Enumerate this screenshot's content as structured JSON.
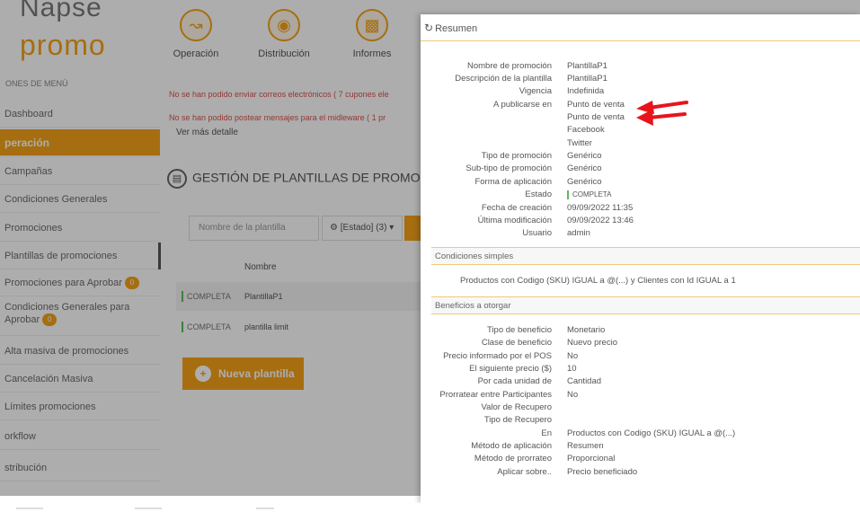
{
  "app": {
    "logo_top": "Napse",
    "logo_bottom": "promo",
    "menu_header": "ONES DE MENÚ",
    "menu": [
      {
        "label": "Dashboard"
      },
      {
        "label": "peración"
      },
      {
        "label": "Campañas"
      },
      {
        "label": "Condiciones Generales"
      },
      {
        "label": "Promociones"
      },
      {
        "label": "Plantillas de promociones"
      },
      {
        "label": "Promociones para Aprobar",
        "badge": "0"
      },
      {
        "label": "Condiciones Generales para",
        "label2": "Aprobar",
        "badge": "0"
      },
      {
        "label": "Alta masiva de promociones"
      },
      {
        "label": "Cancelación Masiva"
      },
      {
        "label": "Límites promociones"
      },
      {
        "label": "orkflow"
      },
      {
        "label": "stribución"
      }
    ],
    "topnav": [
      {
        "label": "Operación",
        "icon": "chart-line-icon"
      },
      {
        "label": "Distribución",
        "icon": "location-pin-icon"
      },
      {
        "label": "Informes",
        "icon": "bar-chart-icon"
      }
    ],
    "errors": [
      "No se han podido enviar correos electrónicos ( 7 cupones ele",
      "No se han podido postear mensajes para el midleware ( 1 pr"
    ],
    "ver_mas": "Ver más detalle",
    "page_title": "GESTIÓN DE PLANTILLAS DE PROMOCIONES",
    "filter_placeholder": "Nombre de la plantilla",
    "filter_state": "[Estado] (3)",
    "table_header": "Nombre",
    "rows": [
      {
        "status": "COMPLETA",
        "name": "PlantillaP1"
      },
      {
        "status": "COMPLETA",
        "name": "plantilla limit"
      }
    ],
    "new_button": "Nueva plantilla"
  },
  "modal": {
    "title": "Resumen",
    "summary": [
      {
        "key": "Nombre de promoción",
        "value": "PlantillaP1"
      },
      {
        "key": "Descripción de la plantilla",
        "value": "PlantillaP1"
      },
      {
        "key": "Vigencia",
        "value": "Indefinida"
      },
      {
        "key": "A publicarse en",
        "values": [
          "Punto de venta",
          "Punto de venta",
          "Facebook",
          "Twitter"
        ]
      },
      {
        "key": "Tipo de promoción",
        "value": "Genérico"
      },
      {
        "key": "Sub-tipo de promoción",
        "value": "Genérico"
      },
      {
        "key": "Forma de aplicación",
        "value": "Genérico"
      },
      {
        "key": "Estado",
        "value": "COMPLETA"
      },
      {
        "key": "Fecha de creación",
        "value": "09/09/2022 11:35"
      },
      {
        "key": "Última modificación",
        "value": "09/09/2022 13:46"
      },
      {
        "key": "Usuario",
        "value": "admin"
      }
    ],
    "conditions_title": "Condiciones simples",
    "conditions_text": "Productos con Codigo (SKU) IGUAL a @(...) y Clientes con Id IGUAL a 1",
    "benefits_title": "Beneficios a otorgar",
    "benefits": [
      {
        "key": "Tipo de beneficio",
        "value": "Monetario"
      },
      {
        "key": "Clase de beneficio",
        "value": "Nuevo precio"
      },
      {
        "key": "Precio informado por el POS",
        "value": "No"
      },
      {
        "key": "El siguiente precio ($)",
        "value": "10"
      },
      {
        "key": "Por cada unidad de",
        "value": "Cantidad"
      },
      {
        "key": "Prorratear entre Participantes",
        "value": "No"
      },
      {
        "key": "Valor de Recupero",
        "value": ""
      },
      {
        "key": "Tipo de Recupero",
        "value": ""
      },
      {
        "key": "En",
        "value": "Productos con Codigo (SKU) IGUAL a @(...)"
      },
      {
        "key": "Método de aplicación",
        "value": "Resumen"
      },
      {
        "key": "Método de prorrateo",
        "value": "Proporcional"
      },
      {
        "key": "Aplicar sobre..",
        "value": "Precio beneficiado"
      }
    ]
  },
  "colors": {
    "accent": "#f5a31a",
    "arrow": "#e8141c",
    "status_ok": "#5cb85c",
    "error_text": "#d9534f"
  }
}
